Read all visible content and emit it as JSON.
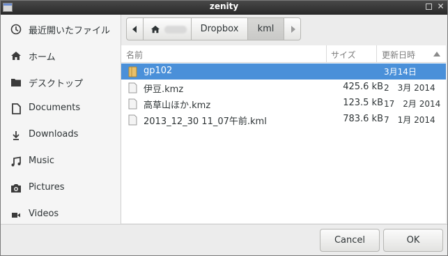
{
  "window": {
    "title": "zenity"
  },
  "sidebar": {
    "items": [
      {
        "label": "最近開いたファイル",
        "icon": "clock-icon"
      },
      {
        "label": "ホーム",
        "icon": "home-icon"
      },
      {
        "label": "デスクトップ",
        "icon": "folder-icon"
      },
      {
        "label": "Documents",
        "icon": "document-icon"
      },
      {
        "label": "Downloads",
        "icon": "download-icon"
      },
      {
        "label": "Music",
        "icon": "music-icon"
      },
      {
        "label": "Pictures",
        "icon": "camera-icon"
      },
      {
        "label": "Videos",
        "icon": "video-icon"
      }
    ]
  },
  "pathbar": {
    "segments": [
      "Dropbox",
      "kml"
    ],
    "active": "kml"
  },
  "filelist": {
    "columns": {
      "name": "名前",
      "size": "サイズ",
      "modified": "更新日時"
    },
    "rows": [
      {
        "name": "gp102",
        "size": "",
        "date": "3月14日",
        "type": "folder",
        "selected": true
      },
      {
        "name": "伊豆.kmz",
        "size": "425.6 kB",
        "date": "2　3月 2014",
        "type": "file"
      },
      {
        "name": "高草山ほか.kmz",
        "size": "123.5 kB",
        "date": "17　2月 2014",
        "type": "file"
      },
      {
        "name": "2013_12_30 11_07午前.kml",
        "size": "783.6 kB",
        "date": "7　1月 2014",
        "type": "file"
      }
    ]
  },
  "buttons": {
    "cancel": "Cancel",
    "ok": "OK"
  },
  "colors": {
    "selection": "#4a90d9",
    "titlebar": "#2b2b2b"
  }
}
